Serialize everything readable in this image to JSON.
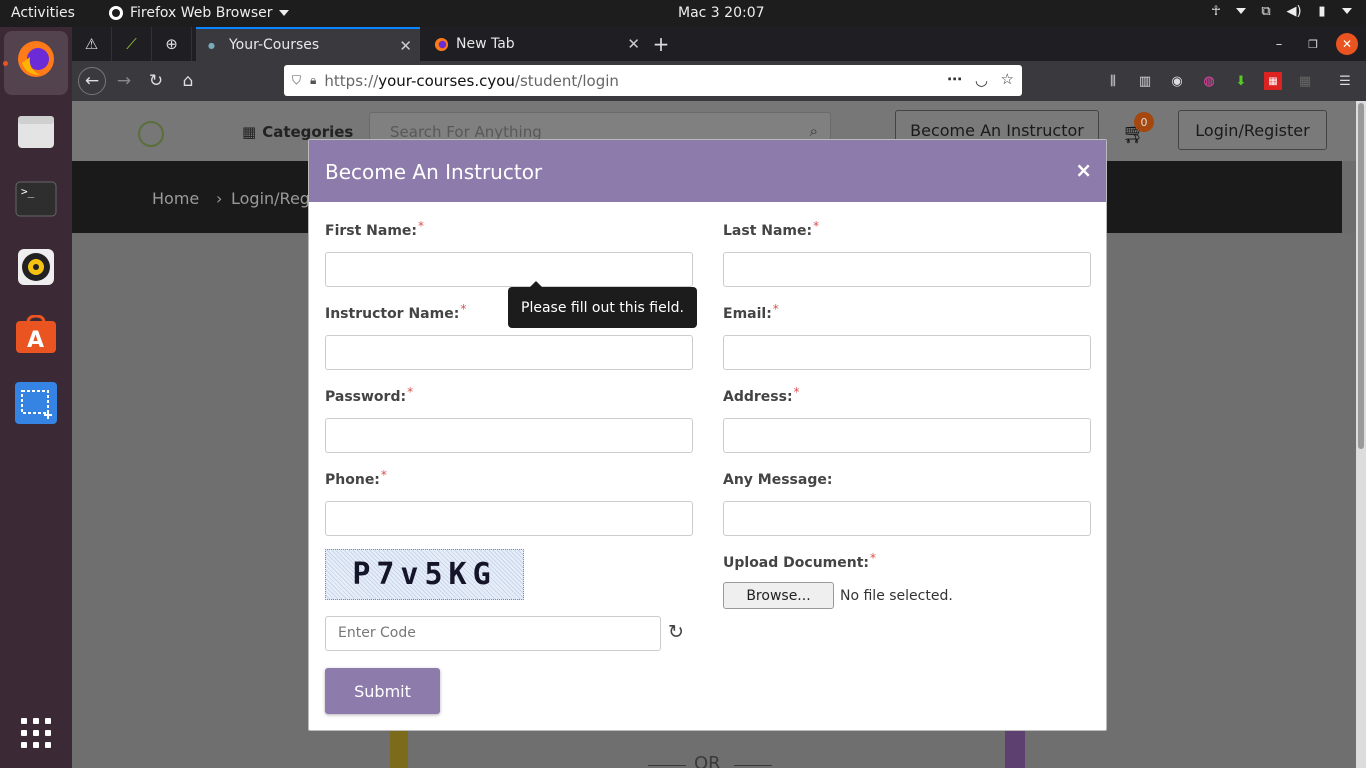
{
  "system_bar": {
    "activities": "Activities",
    "app_name": "Firefox Web Browser",
    "clock": "Mac 3  20:07"
  },
  "dock": {
    "items": [
      "firefox-icon",
      "files-icon",
      "terminal-icon",
      "rhythmbox-icon",
      "software-center-icon",
      "screenshot-icon",
      "app-grid-icon"
    ]
  },
  "browser": {
    "tabs": [
      {
        "title": "Your-Courses",
        "active": true
      },
      {
        "title": "New Tab",
        "active": false
      }
    ],
    "url": {
      "scheme": "https://",
      "host": "your-courses.cyou",
      "path": "/student/login"
    }
  },
  "site_header": {
    "categories_label": "Categories",
    "search_placeholder": "Search For Anything",
    "become_instructor_label": "Become An Instructor",
    "cart_count": "0",
    "login_register_label": "Login/Register"
  },
  "breadcrumb": {
    "home": "Home",
    "current": "Login/Regi"
  },
  "page_below": {
    "or_text": "OR"
  },
  "modal": {
    "title": "Become An Instructor",
    "close_symbol": "×",
    "required_marker": "*",
    "fields": {
      "first_name": "First Name:",
      "last_name": "Last Name:",
      "instructor_name": "Instructor Name:",
      "email": "Email:",
      "password": "Password:",
      "address": "Address:",
      "phone": "Phone:",
      "any_message": "Any Message:",
      "upload_document": "Upload Document:"
    },
    "validation_tooltip": "Please fill out this field.",
    "captcha_text": "P7v5KG",
    "code_placeholder": "Enter Code",
    "browse_label": "Browse...",
    "no_file_text": "No file selected.",
    "submit_label": "Submit"
  },
  "colors": {
    "modal_header": "#8d7bab",
    "submit_button": "#8d7bab",
    "required_asterisk": "#d9534f",
    "dock_background": "#3b2a36",
    "active_tab_accent": "#0a84ff"
  }
}
